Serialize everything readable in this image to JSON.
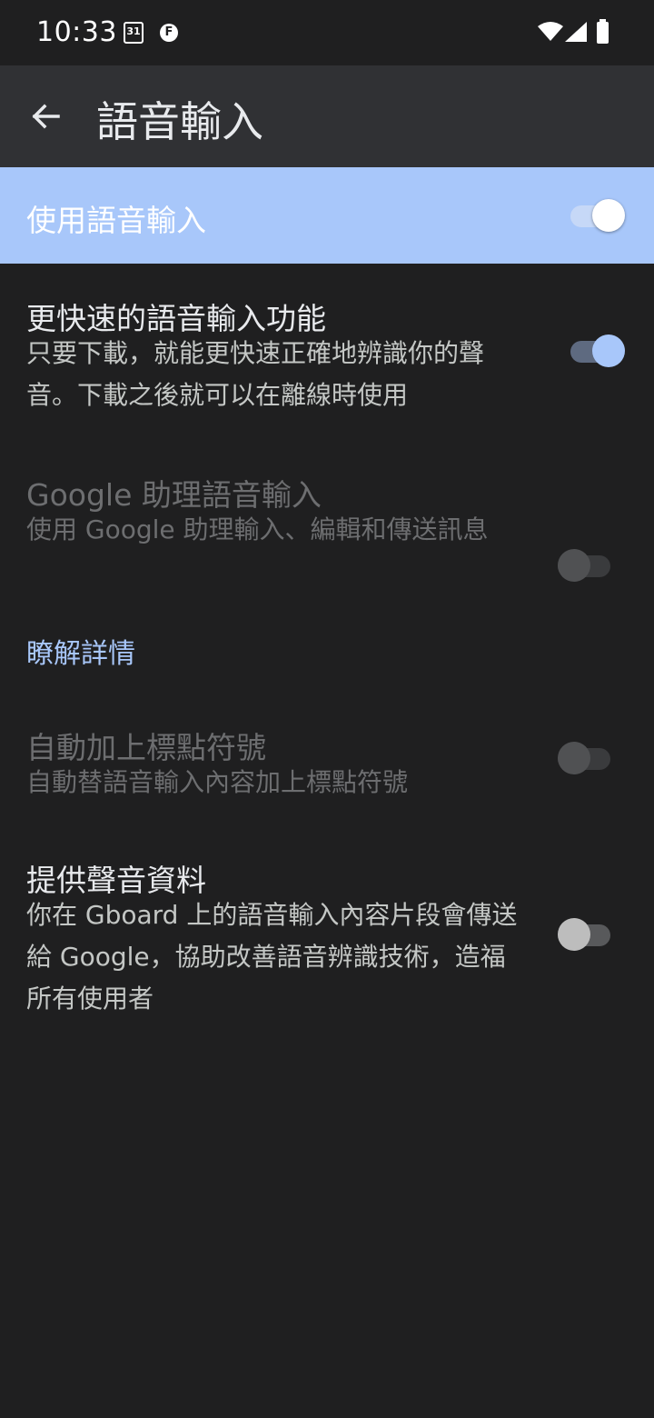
{
  "status_bar": {
    "time": "10:33",
    "calendar_day": "31",
    "notification_letter": "F",
    "icons": [
      "calendar-icon",
      "notification-icon",
      "wifi-icon",
      "signal-icon",
      "battery-icon"
    ]
  },
  "app_bar": {
    "title": "語音輸入",
    "back_icon": "arrow-left-icon"
  },
  "master_switch": {
    "label": "使用語音輸入",
    "checked": true
  },
  "settings": [
    {
      "title": "更快速的語音輸入功能",
      "summary": "只要下載，就能更快速正確地辨識你的聲音。下載之後就可以在離線時使用",
      "checked": true,
      "enabled": true
    },
    {
      "title": "Google 助理語音輸入",
      "summary": "使用 Google 助理輸入、編輯和傳送訊息",
      "checked": false,
      "enabled": false
    },
    {
      "title": "自動加上標點符號",
      "summary": "自動替語音輸入內容加上標點符號",
      "checked": false,
      "enabled": false
    },
    {
      "title": "提供聲音資料",
      "summary": "你在 Gboard 上的語音輸入內容片段會傳送給 Google，協助改善語音辨識技術，造福所有使用者",
      "checked": false,
      "enabled": true
    }
  ],
  "learn_more_link": "瞭解詳情",
  "colors": {
    "background": "#1f1f20",
    "app_bar": "#303134",
    "accent": "#a8c7fa",
    "text_primary": "#e8eaed",
    "text_secondary": "#c4c7c5",
    "text_disabled": "#6d6e70"
  }
}
